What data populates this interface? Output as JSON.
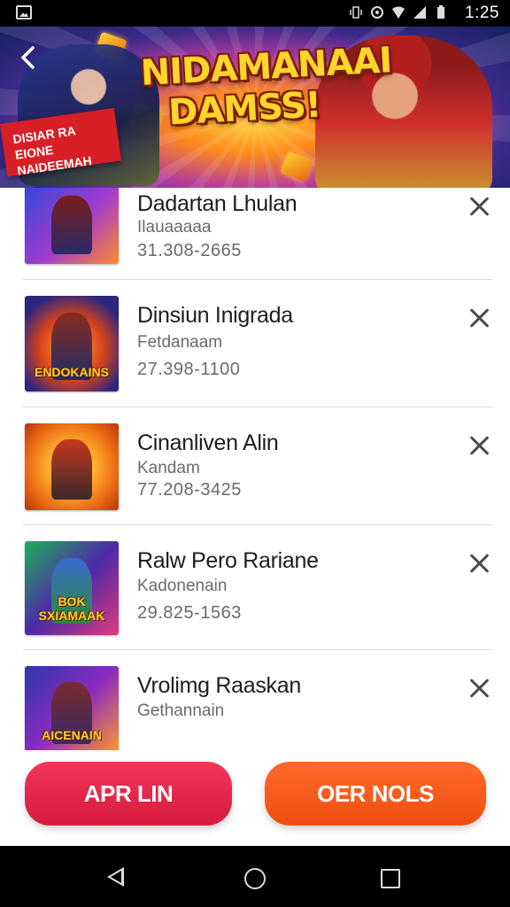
{
  "status_bar": {
    "time": "1:25",
    "icons": [
      "gallery-icon",
      "vibrate-icon",
      "sync-icon",
      "wifi-icon",
      "signal-icon",
      "battery-icon"
    ]
  },
  "banner": {
    "title_line1": "NIDAMANAAI",
    "title_line2": "DAMSS!",
    "badge_line1": "DISIAR RA EIONE",
    "badge_line2": "NAIDEEMAH"
  },
  "items": [
    {
      "title": "Dadartan Lhulan",
      "subtitle": "Ilauaaaaa",
      "code": "31.308-2665",
      "thumb_caption": ""
    },
    {
      "title": "Dinsiun Inigrada",
      "subtitle": "Fetdanaam",
      "code": "27.398-1100",
      "thumb_caption": "ENDOKAINS"
    },
    {
      "title": "Cinanliven Alin",
      "subtitle": "Kandam",
      "code": "77.208-3425",
      "thumb_caption": ""
    },
    {
      "title": "Ralw Pero Rariane",
      "subtitle": "Kadonenain",
      "code": "29.825-1563",
      "thumb_caption": "BOK SXIAMAAK"
    },
    {
      "title": "Vrolimg Raaskan",
      "subtitle": "Gethannain",
      "code": "",
      "thumb_caption": "AICENAIN"
    }
  ],
  "buttons": {
    "left_label": "APR LIN",
    "right_label": "OER NOLS"
  },
  "colors": {
    "left_button": "#e3244b",
    "right_button": "#f55a1c"
  }
}
